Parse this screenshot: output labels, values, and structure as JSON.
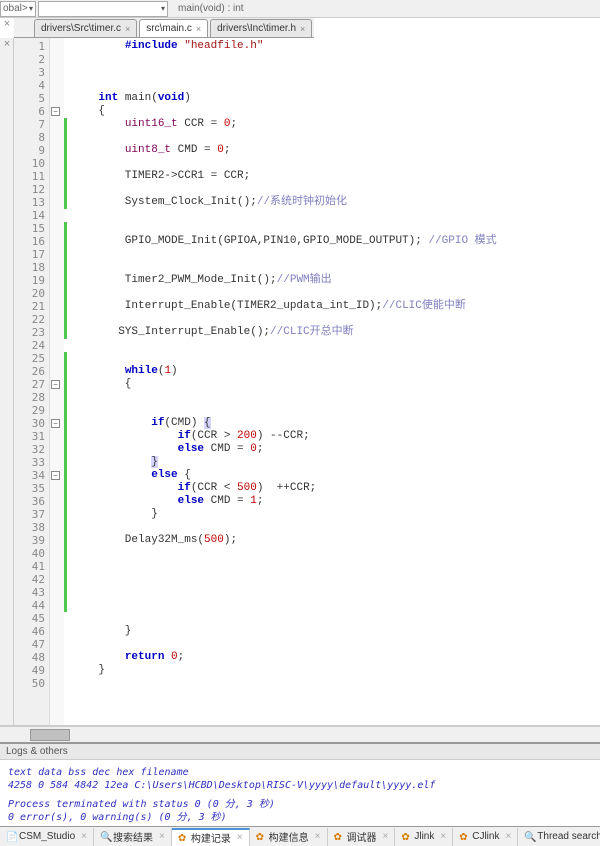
{
  "toolbar": {
    "scope_label": "obal>",
    "func_label": "main(void) : int"
  },
  "tabs": [
    {
      "label": "drivers\\Src\\timer.c",
      "active": false
    },
    {
      "label": "src\\main.c",
      "active": true
    },
    {
      "label": "drivers\\Inc\\timer.h",
      "active": false
    }
  ],
  "code": {
    "lines": [
      {
        "n": 1,
        "seg": [
          {
            "t": "        "
          },
          {
            "t": "#include ",
            "c": "kw"
          },
          {
            "t": "\"headfile.h\"",
            "c": "str"
          }
        ]
      },
      {
        "n": 2,
        "seg": [
          {
            "t": " "
          }
        ]
      },
      {
        "n": 3,
        "seg": [
          {
            "t": " "
          }
        ]
      },
      {
        "n": 4,
        "seg": [
          {
            "t": " "
          }
        ]
      },
      {
        "n": 5,
        "seg": [
          {
            "t": "    "
          },
          {
            "t": "int",
            "c": "kw"
          },
          {
            "t": " main("
          },
          {
            "t": "void",
            "c": "kw"
          },
          {
            "t": ")"
          }
        ]
      },
      {
        "n": 6,
        "seg": [
          {
            "t": "    {"
          }
        ],
        "fold": "-"
      },
      {
        "n": 7,
        "seg": [
          {
            "t": "        "
          },
          {
            "t": "uint16_t",
            "c": "ty"
          },
          {
            "t": " CCR = "
          },
          {
            "t": "0",
            "c": "num"
          },
          {
            "t": ";"
          }
        ],
        "bar": true
      },
      {
        "n": 8,
        "seg": [
          {
            "t": " "
          }
        ],
        "bar": true
      },
      {
        "n": 9,
        "seg": [
          {
            "t": "        "
          },
          {
            "t": "uint8_t",
            "c": "ty"
          },
          {
            "t": " CMD = "
          },
          {
            "t": "0",
            "c": "num"
          },
          {
            "t": ";"
          }
        ],
        "bar": true
      },
      {
        "n": 10,
        "seg": [
          {
            "t": " "
          }
        ],
        "bar": true
      },
      {
        "n": 11,
        "seg": [
          {
            "t": "        TIMER2->CCR1 = CCR;"
          }
        ],
        "bar": true
      },
      {
        "n": 12,
        "seg": [
          {
            "t": " "
          }
        ],
        "bar": true
      },
      {
        "n": 13,
        "seg": [
          {
            "t": "        System_Clock_Init();"
          },
          {
            "t": "//系统时钟初始化",
            "c": "cm"
          }
        ],
        "bar": true
      },
      {
        "n": 14,
        "seg": [
          {
            "t": " "
          }
        ]
      },
      {
        "n": 15,
        "seg": [
          {
            "t": " "
          }
        ],
        "bar": true
      },
      {
        "n": 16,
        "seg": [
          {
            "t": "        GPIO_MODE_Init(GPIOA,PIN10,GPIO_MODE_OUTPUT); "
          },
          {
            "t": "//GPIO 模式",
            "c": "cm"
          }
        ],
        "bar": true
      },
      {
        "n": 17,
        "seg": [
          {
            "t": " "
          }
        ],
        "bar": true
      },
      {
        "n": 18,
        "seg": [
          {
            "t": " "
          }
        ],
        "bar": true
      },
      {
        "n": 19,
        "seg": [
          {
            "t": "        Timer2_PWM_Mode_Init();"
          },
          {
            "t": "//PWM输出",
            "c": "cm"
          }
        ],
        "bar": true
      },
      {
        "n": 20,
        "seg": [
          {
            "t": " "
          }
        ],
        "bar": true
      },
      {
        "n": 21,
        "seg": [
          {
            "t": "        Interrupt_Enable(TIMER2_updata_int_ID);"
          },
          {
            "t": "//CLIC使能中断",
            "c": "cm"
          }
        ],
        "bar": true
      },
      {
        "n": 22,
        "seg": [
          {
            "t": " "
          }
        ],
        "bar": true
      },
      {
        "n": 23,
        "seg": [
          {
            "t": "       SYS_Interrupt_Enable();"
          },
          {
            "t": "//CLIC开总中断",
            "c": "cm"
          }
        ],
        "bar": true
      },
      {
        "n": 24,
        "seg": [
          {
            "t": " "
          }
        ]
      },
      {
        "n": 25,
        "seg": [
          {
            "t": " "
          }
        ],
        "bar": true
      },
      {
        "n": 26,
        "seg": [
          {
            "t": "        "
          },
          {
            "t": "while",
            "c": "kw"
          },
          {
            "t": "("
          },
          {
            "t": "1",
            "c": "num"
          },
          {
            "t": ")"
          }
        ],
        "bar": true
      },
      {
        "n": 27,
        "seg": [
          {
            "t": "        {"
          }
        ],
        "bar": true,
        "fold": "-"
      },
      {
        "n": 28,
        "seg": [
          {
            "t": " "
          }
        ],
        "bar": true
      },
      {
        "n": 29,
        "seg": [
          {
            "t": " "
          }
        ],
        "bar": true
      },
      {
        "n": 30,
        "seg": [
          {
            "t": "            "
          },
          {
            "t": "if",
            "c": "kw"
          },
          {
            "t": "(CMD) "
          },
          {
            "t": "{",
            "c": "hl"
          }
        ],
        "bar": true,
        "fold": "-"
      },
      {
        "n": 31,
        "seg": [
          {
            "t": "                "
          },
          {
            "t": "if",
            "c": "kw"
          },
          {
            "t": "(CCR > "
          },
          {
            "t": "200",
            "c": "num"
          },
          {
            "t": ") --CCR;"
          }
        ],
        "bar": true
      },
      {
        "n": 32,
        "seg": [
          {
            "t": "                "
          },
          {
            "t": "else",
            "c": "kw"
          },
          {
            "t": " CMD = "
          },
          {
            "t": "0",
            "c": "num"
          },
          {
            "t": ";"
          }
        ],
        "bar": true
      },
      {
        "n": 33,
        "seg": [
          {
            "t": "            "
          },
          {
            "t": "}",
            "c": "hl"
          }
        ],
        "bar": true
      },
      {
        "n": 34,
        "seg": [
          {
            "t": "            "
          },
          {
            "t": "else",
            "c": "kw"
          },
          {
            "t": " {"
          }
        ],
        "bar": true,
        "fold": "-"
      },
      {
        "n": 35,
        "seg": [
          {
            "t": "                "
          },
          {
            "t": "if",
            "c": "kw"
          },
          {
            "t": "(CCR < "
          },
          {
            "t": "500",
            "c": "num"
          },
          {
            "t": ")  ++CCR;"
          }
        ],
        "bar": true
      },
      {
        "n": 36,
        "seg": [
          {
            "t": "                "
          },
          {
            "t": "else",
            "c": "kw"
          },
          {
            "t": " CMD = "
          },
          {
            "t": "1",
            "c": "num"
          },
          {
            "t": ";"
          }
        ],
        "bar": true
      },
      {
        "n": 37,
        "seg": [
          {
            "t": "            }"
          }
        ],
        "bar": true
      },
      {
        "n": 38,
        "seg": [
          {
            "t": " "
          }
        ],
        "bar": true
      },
      {
        "n": 39,
        "seg": [
          {
            "t": "        Delay32M_ms("
          },
          {
            "t": "500",
            "c": "num"
          },
          {
            "t": ");"
          }
        ],
        "bar": true
      },
      {
        "n": 40,
        "seg": [
          {
            "t": " "
          }
        ],
        "bar": true
      },
      {
        "n": 41,
        "seg": [
          {
            "t": " "
          }
        ],
        "bar": true
      },
      {
        "n": 42,
        "seg": [
          {
            "t": " "
          }
        ],
        "bar": true
      },
      {
        "n": 43,
        "seg": [
          {
            "t": " "
          }
        ],
        "bar": true
      },
      {
        "n": 44,
        "seg": [
          {
            "t": " "
          }
        ],
        "bar": true
      },
      {
        "n": 45,
        "seg": [
          {
            "t": " "
          }
        ]
      },
      {
        "n": 46,
        "seg": [
          {
            "t": "        }"
          }
        ]
      },
      {
        "n": 47,
        "seg": [
          {
            "t": " "
          }
        ]
      },
      {
        "n": 48,
        "seg": [
          {
            "t": "        "
          },
          {
            "t": "return",
            "c": "kw"
          },
          {
            "t": " "
          },
          {
            "t": "0",
            "c": "num"
          },
          {
            "t": ";"
          }
        ]
      },
      {
        "n": 49,
        "seg": [
          {
            "t": "    }"
          }
        ]
      },
      {
        "n": 50,
        "seg": [
          {
            "t": " "
          }
        ]
      }
    ]
  },
  "logs": {
    "title": "Logs & others",
    "header": "   text    data     bss     dec     hex filename",
    "row": "   4258       0     584    4842    12ea C:\\Users\\HCBD\\Desktop\\RISC-V\\yyyy\\default\\yyyy.elf",
    "status1": "Process terminated with status 0 (0 分, 3 秒)",
    "status2": "0 error(s), 0 warning(s) (0 分, 3 秒)"
  },
  "bottom_tabs": [
    {
      "icon": "doc",
      "label": "CSM_Studio",
      "active": false
    },
    {
      "icon": "mag",
      "label": "搜索结果",
      "active": false
    },
    {
      "icon": "gear",
      "label": "构建记录",
      "active": true
    },
    {
      "icon": "gear",
      "label": "构建信息",
      "active": false
    },
    {
      "icon": "gear",
      "label": "调试器",
      "active": false
    },
    {
      "icon": "gear",
      "label": "Jlink",
      "active": false
    },
    {
      "icon": "gear",
      "label": "CJlink",
      "active": false
    },
    {
      "icon": "mag",
      "label": "Thread search",
      "active": false
    }
  ]
}
